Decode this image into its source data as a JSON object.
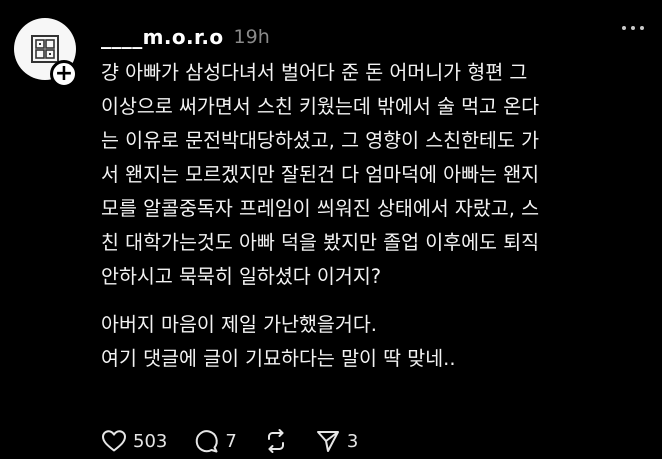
{
  "post": {
    "username": "____m.o.r.o",
    "time": "19h",
    "paragraph1": [
      "걍 아빠가 삼성다녀서 벌어다 준 돈 어머니가 형편 그",
      "이상으로 써가면서 스친 키웠는데 밖에서 술 먹고 온다",
      "는 이유로 문전박대당하셨고, 그 영향이 스친한테도 가",
      "서 왠지는 모르겠지만 잘된건 다 엄마덕에 아빠는 왠지",
      "모를 알콜중독자 프레임이 씌워진 상태에서 자랐고, 스",
      "친 대학가는것도 아빠 덕을 봤지만 졸업 이후에도 퇴직",
      "안하시고 묵묵히 일하셨다 이거지?"
    ],
    "paragraph2": [
      "아버지 마음이 제일 가난했을거다.",
      "여기 댓글에 글이 기묘하다는 말이 딱 맞네.."
    ]
  },
  "actions": {
    "likes": "503",
    "replies": "7",
    "shares": "3"
  },
  "icons": {
    "like": "heart-icon",
    "reply": "comment-icon",
    "repost": "repost-icon",
    "share": "send-icon",
    "more": "more-icon",
    "follow": "plus-icon"
  }
}
